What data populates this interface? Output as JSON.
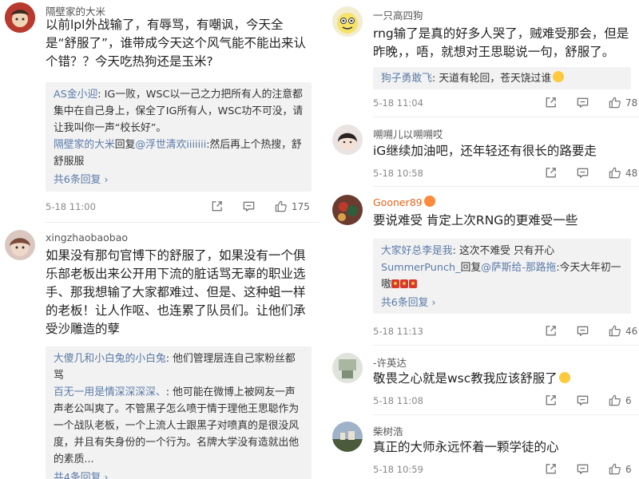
{
  "left": {
    "c1": {
      "user": "隔壁家的大米",
      "text": "以前lpl外战输了，有辱骂，有嘲讽，今天全是“舒服了”，谁带成今天这个风气能不能出来认个错？？今天吃热狗还是玉米?",
      "replies": [
        {
          "name": "AS金小迎",
          "sep": ":",
          "text": " IG一败，WSC以一己之力把所有人的注意都集中在自己身上，保全了IG所有人，WSC功不可没，请让我叫你一声“校长好”。"
        },
        {
          "name": "隔壁家的大米",
          "mid": "回复",
          "link": "@浮世清欢iiiiiii",
          "text": ":然后再上个热搜，舒舒服服"
        }
      ],
      "more": "共6条回复 ›",
      "time": "5-18 11:00",
      "likes": "175"
    },
    "c2": {
      "user": "xingzhaobaobao",
      "text": "如果没有那句官博下的舒服了，如果没有一个俱乐部老板出来公开用下流的脏话骂无辜的职业选手、那我想输了大家都难过、但是、这种蛆一样的老板！让人作呕、也连累了队员们。让他们承受沙雕造的孽",
      "replies": [
        {
          "name": "大傻几和小白兔的小白兔",
          "sep": ":",
          "text": " 他们管理层连自己家粉丝都骂"
        },
        {
          "name": "百无一用是情深深深深、",
          "sep": ":",
          "text": " 他可能在微博上被网友一声声老公叫爽了。不管黑子怎么喷于情于理他王思聪作为一个战队老板，一个上流人士跟黑子对喷真的是很没风度，并且有失身份的一个行为。名牌大学没有造就出他的素质..."
        }
      ],
      "more": "共4条回复 ›"
    }
  },
  "right": {
    "c1": {
      "user": "一只高四狗",
      "text": "rng输了是真的好多人哭了，贼难受那会，但是昨晚，，唔，就想对王思聪说一句，舒服了。",
      "reply": {
        "name": "狗子勇敢飞",
        "sep": ":",
        "text": " 天道有轮回，苍天饶过谁"
      },
      "time": "5-18 11:04",
      "likes": "78"
    },
    "c2": {
      "user": "嗍嗍儿以嗍嗍哎",
      "text": "iG继续加油吧，还年轻还有很长的路要走",
      "time": "5-18 10:58",
      "likes": "48"
    },
    "c3": {
      "user": "Gooner89",
      "text": "要说难受  肯定上次RNG的更难受一些",
      "replies": [
        {
          "name": "大家好总李是我",
          "sep": ":",
          "text": " 这次不难受  只有开心"
        },
        {
          "name": "SummerPunch_",
          "mid": "回复",
          "link": "@萨斯给-那路拖",
          "text": ":今天大年初一嗷"
        }
      ],
      "more": "共6条回复 ›",
      "time": "5-18 11:13",
      "likes": "46"
    },
    "c4": {
      "user": "-许英达",
      "text": "敬畏之心就是wsc教我应该舒服了",
      "time": "5-18 11:08",
      "likes": "6"
    },
    "c5": {
      "user": "柴树浩",
      "text": "真正的大师永远怀着一颗学徒的心",
      "time": "5-18 10:59",
      "likes": "6"
    }
  },
  "icons": [
    "share-icon",
    "comment-icon",
    "like-icon"
  ],
  "colors": {
    "link": "#5b7ba8",
    "vip_name": "#e8631c",
    "reply_bg": "#f2f2f2"
  }
}
